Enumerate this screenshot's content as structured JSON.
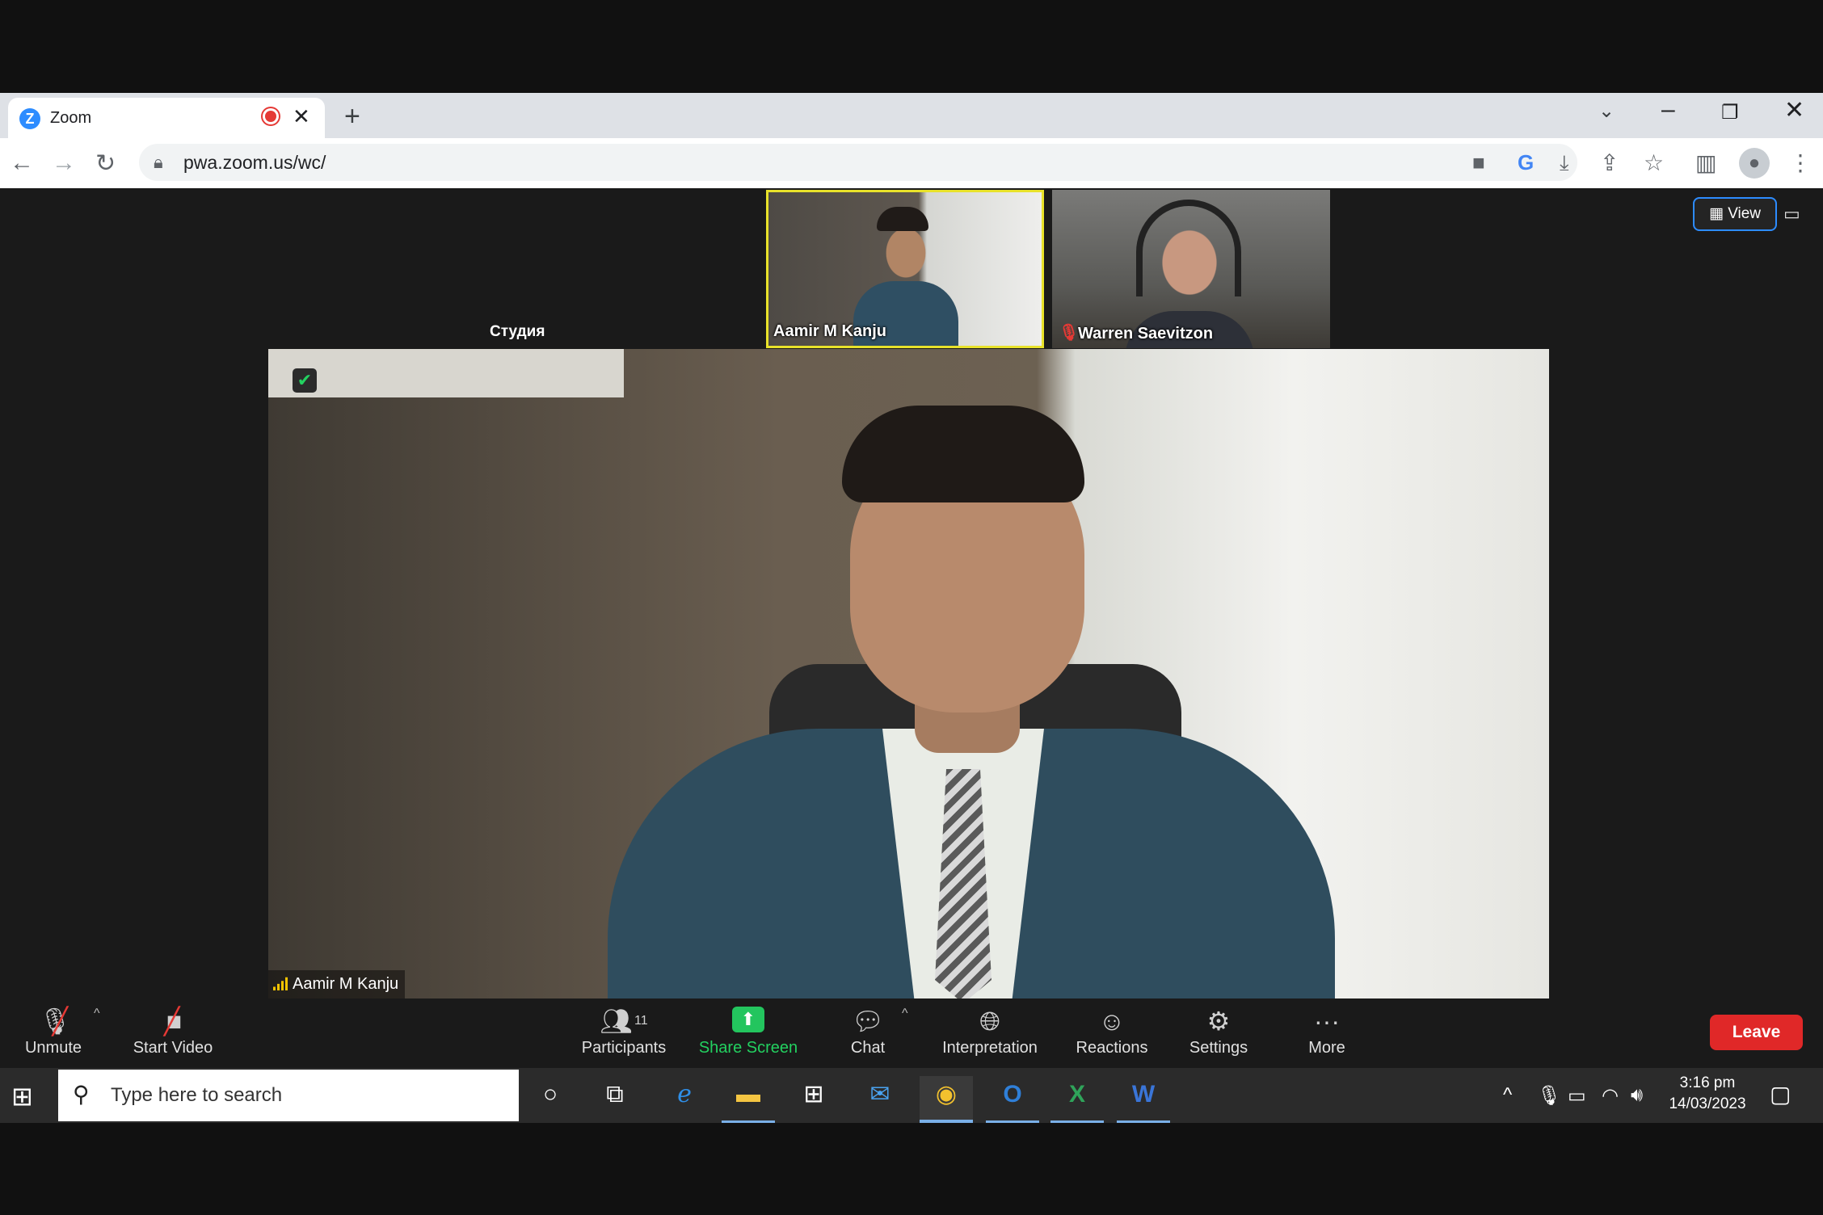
{
  "browser": {
    "tab_title": "Zoom",
    "tab_close": "✕",
    "new_tab": "+",
    "url": "pwa.zoom.us/wc/",
    "favicon_letter": "Z"
  },
  "meeting": {
    "studio_label": "Студия",
    "thumbnails": [
      {
        "name": "Aamir M Kanju",
        "active_speaker": true
      },
      {
        "name": "Warren Saevitzon",
        "muted": true
      }
    ],
    "main_speaker": "Aamir M Kanju",
    "view_label": "View"
  },
  "controls": {
    "unmute": "Unmute",
    "start_video": "Start Video",
    "participants": "Participants",
    "participant_count": "11",
    "share_screen": "Share Screen",
    "chat": "Chat",
    "interpretation": "Interpretation",
    "reactions": "Reactions",
    "settings": "Settings",
    "more": "More",
    "leave": "Leave"
  },
  "taskbar": {
    "search_placeholder": "Type here to search",
    "time": "3:16 pm",
    "date": "14/03/2023",
    "apps": [
      "task-view",
      "edge",
      "file-explorer",
      "store",
      "mail",
      "chrome",
      "outlook",
      "excel",
      "word"
    ]
  },
  "colors": {
    "zoom_blue": "#2d8cff",
    "leave_red": "#e02828",
    "share_green": "#23c55e",
    "active_speaker_border": "#e8e22a"
  }
}
